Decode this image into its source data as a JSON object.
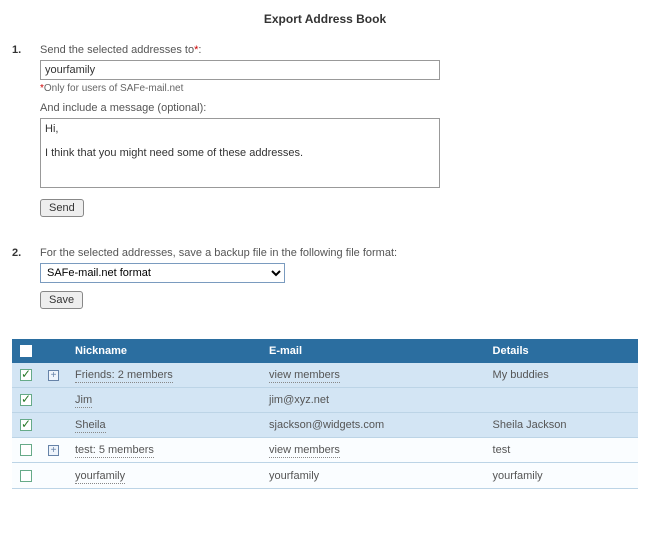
{
  "title": "Export Address Book",
  "step1": {
    "num": "1.",
    "label": "Send the selected addresses to",
    "required_mark": "*",
    "colon": ":",
    "recipient_value": "yourfamily",
    "footnote_star": "*",
    "footnote_text": "Only for users of SAFe-mail.net",
    "message_label": "And include a message (optional):",
    "message_value": "Hi,\n\nI think that you might need some of these addresses.",
    "send_label": "Send"
  },
  "step2": {
    "num": "2.",
    "label": "For the selected addresses, save a backup file in the following file format:",
    "format_selected": "SAFe-mail.net format",
    "save_label": "Save"
  },
  "table": {
    "headers": {
      "nickname": "Nickname",
      "email": "E-mail",
      "details": "Details"
    },
    "rows": [
      {
        "checked": true,
        "expandable": true,
        "nickname": "Friends: 2 members",
        "email": "view members",
        "details": "My buddies"
      },
      {
        "checked": true,
        "expandable": false,
        "nickname": "Jim",
        "email": "jim@xyz.net",
        "details": ""
      },
      {
        "checked": true,
        "expandable": false,
        "nickname": "Sheila",
        "email": "sjackson@widgets.com",
        "details": "Sheila Jackson"
      },
      {
        "checked": false,
        "expandable": true,
        "nickname": "test: 5 members",
        "email": "view members",
        "details": "test"
      },
      {
        "checked": false,
        "expandable": false,
        "nickname": "yourfamily",
        "email": "yourfamily",
        "details": "yourfamily"
      }
    ]
  }
}
